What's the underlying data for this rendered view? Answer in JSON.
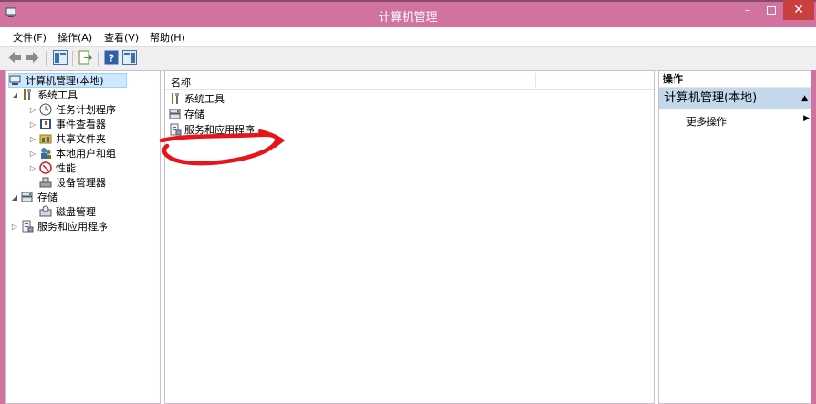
{
  "window": {
    "title": "计算机管理"
  },
  "menu": [
    "文件(F)",
    "操作(A)",
    "查看(V)",
    "帮助(H)"
  ],
  "tree": {
    "root": "计算机管理(本地)",
    "system_tools": "系统工具",
    "task_scheduler": "任务计划程序",
    "event_viewer": "事件查看器",
    "shared_folders": "共享文件夹",
    "local_users": "本地用户和组",
    "performance": "性能",
    "device_manager": "设备管理器",
    "storage": "存储",
    "disk_management": "磁盘管理",
    "services": "服务和应用程序"
  },
  "list": {
    "column_name": "名称",
    "items": [
      "系统工具",
      "存储",
      "服务和应用程序"
    ]
  },
  "actions": {
    "header": "操作",
    "section": "计算机管理(本地)",
    "more": "更多操作"
  },
  "colors": {
    "titlebar": "#d2739f",
    "close": "#c8413f",
    "selection": "#cde8ff",
    "action_section": "#c3d8ea",
    "annotation": "#e8141a"
  }
}
